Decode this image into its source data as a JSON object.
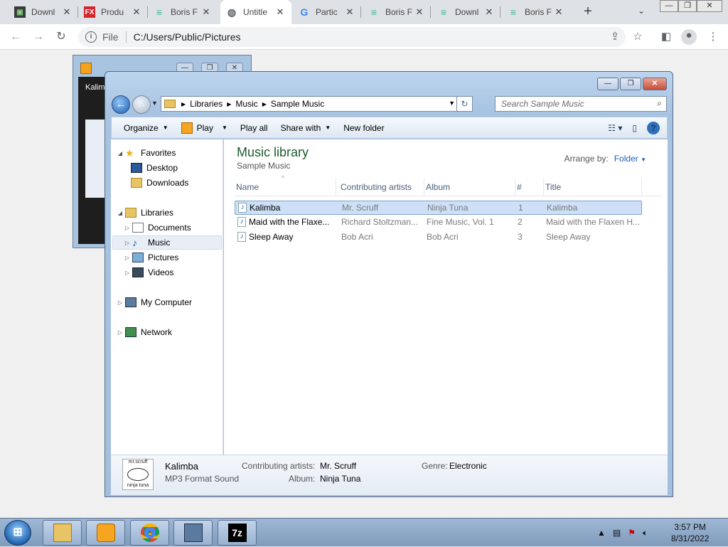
{
  "browser": {
    "tabs": [
      {
        "title": "Downl",
        "favicon": "monitor"
      },
      {
        "title": "Produ",
        "favicon": "fx"
      },
      {
        "title": "Boris F",
        "favicon": "boris"
      },
      {
        "title": "Untitle",
        "favicon": "globe",
        "active": true
      },
      {
        "title": "Partic",
        "favicon": "google"
      },
      {
        "title": "Boris F",
        "favicon": "boris"
      },
      {
        "title": "Downl",
        "favicon": "boris"
      },
      {
        "title": "Boris F",
        "favicon": "boris"
      }
    ],
    "close_glyph": "✕",
    "new_tab_glyph": "+",
    "url_scheme": "File",
    "url": "C:/Users/Public/Pictures",
    "window_controls": [
      "—",
      "❐",
      "✕"
    ]
  },
  "background_window": {
    "title": "Kalim"
  },
  "explorer": {
    "breadcrumb": [
      "Libraries",
      "Music",
      "Sample Music"
    ],
    "search_placeholder": "Search Sample Music",
    "commands": {
      "organize": "Organize",
      "play": "Play",
      "play_all": "Play all",
      "share_with": "Share with",
      "new_folder": "New folder"
    },
    "nav": {
      "favorites": "Favorites",
      "desktop": "Desktop",
      "downloads": "Downloads",
      "libraries": "Libraries",
      "documents": "Documents",
      "music": "Music",
      "pictures": "Pictures",
      "videos": "Videos",
      "my_computer": "My Computer",
      "network": "Network"
    },
    "library_title": "Music library",
    "library_subtitle": "Sample Music",
    "arrange_label": "Arrange by:",
    "arrange_value": "Folder",
    "columns": [
      "Name",
      "Contributing artists",
      "Album",
      "#",
      "Title"
    ],
    "rows": [
      {
        "name": "Kalimba",
        "artist": "Mr. Scruff",
        "album": "Ninja Tuna",
        "num": "1",
        "title": "Kalimba",
        "selected": true
      },
      {
        "name": "Maid with the Flaxe...",
        "artist": "Richard Stoltzman...",
        "album": "Fine Music, Vol. 1",
        "num": "2",
        "title": "Maid with the Flaxen H..."
      },
      {
        "name": "Sleep Away",
        "artist": "Bob Acri",
        "album": "Bob Acri",
        "num": "3",
        "title": "Sleep Away"
      }
    ],
    "details": {
      "name": "Kalimba",
      "type": "MP3 Format Sound",
      "artists_label": "Contributing artists:",
      "artists_value": "Mr. Scruff",
      "album_label": "Album:",
      "album_value": "Ninja Tuna",
      "genre_label": "Genre:",
      "genre_value": "Electronic",
      "thumb_top": "mr.scruff",
      "thumb_bottom": "ninja tuna"
    }
  },
  "taskbar": {
    "clock_time": "3:57 PM",
    "clock_date": "8/31/2022"
  }
}
